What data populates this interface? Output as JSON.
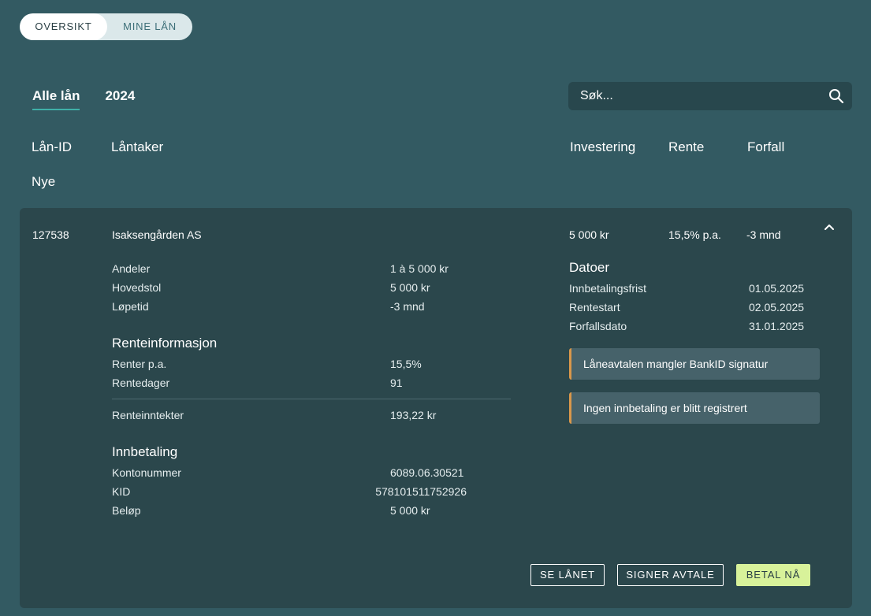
{
  "toggle": {
    "overview": "OVERSIKT",
    "my_loans": "MINE LÅN"
  },
  "tabs": [
    {
      "label": "Alle lån"
    },
    {
      "label": "2024"
    }
  ],
  "search": {
    "placeholder": "Søk..."
  },
  "columns": {
    "loan_id": "Lån-ID",
    "borrower": "Låntaker",
    "investment": "Investering",
    "rate": "Rente",
    "due": "Forfall"
  },
  "section": "Nye",
  "loan": {
    "id": "127538",
    "borrower": "Isaksengården AS",
    "investment": "5 000 kr",
    "rate": "15,5% p.a.",
    "due": "-3 mnd",
    "details": [
      {
        "label": "Andeler",
        "value": "1 à 5 000 kr"
      },
      {
        "label": "Hovedstol",
        "value": "5 000 kr"
      },
      {
        "label": "Løpetid",
        "value": "-3 mnd"
      }
    ],
    "interest": {
      "title": "Renteinformasjon",
      "rows": [
        {
          "label": "Renter p.a.",
          "value": "15,5%"
        },
        {
          "label": "Rentedager",
          "value": "91"
        }
      ],
      "total": {
        "label": "Renteinntekter",
        "value": "193,22 kr"
      }
    },
    "payment": {
      "title": "Innbetaling",
      "rows": [
        {
          "label": "Kontonummer",
          "value": "6089.06.30521"
        },
        {
          "label": "KID",
          "value": "578101511752926"
        },
        {
          "label": "Beløp",
          "value": "5 000 kr"
        }
      ]
    },
    "dates": {
      "title": "Datoer",
      "rows": [
        {
          "label": "Innbetalingsfrist",
          "value": "01.05.2025"
        },
        {
          "label": "Rentestart",
          "value": "02.05.2025"
        },
        {
          "label": "Forfallsdato",
          "value": "31.01.2025"
        }
      ]
    },
    "alerts": [
      "Låneavtalen mangler BankID signatur",
      "Ingen innbetaling er blitt registrert"
    ],
    "actions": {
      "view": "SE LÅNET",
      "sign": "SIGNER AVTALE",
      "pay": "BETAL NÅ"
    }
  },
  "colors": {
    "background": "#335a62",
    "card": "#2b474c",
    "accent": "#3fb0a8",
    "warning": "#d9984b",
    "primary_button": "#d8f29a"
  }
}
